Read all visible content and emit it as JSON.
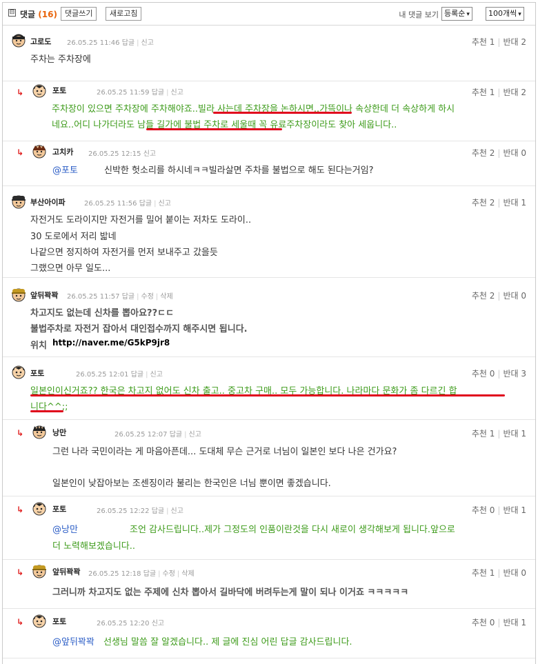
{
  "header": {
    "toggle_icon": "⊟",
    "title": "댓글",
    "count": "(16)",
    "write_button": "댓글쓰기",
    "refresh_button": "새로고침",
    "my_comments": "내 댓글 보기",
    "sort_select": "등록순",
    "per_page_select": "100개씩"
  },
  "labels": {
    "reply": "답글",
    "report": "신고",
    "edit": "수정",
    "delete": "삭제",
    "up": "추천",
    "down": "반대",
    "reply_arrow": "↳",
    "location_label": "위치"
  },
  "comments": [
    {
      "nick": "고로도",
      "date": "26.05.25 11:46",
      "up": "1",
      "down": "2",
      "lines": [
        "주차는 주차장에"
      ]
    },
    {
      "nick": "포토",
      "date": "26.05.25 11:59",
      "up": "1",
      "down": "2",
      "lines": [
        "주차장이 있으면 주차장에 주차해야죠..빌라 사는데 주차장을 논하시면..가뜩이나 속상한데 더 속상하게 하시",
        "네요..어디 나가더라도 남들 길가에 불법 주차로 세울때 꼭 유료주차장이라도 찾아 세웁니다.."
      ]
    },
    {
      "nick": "고치카",
      "date": "26.05.25 12:15",
      "up": "2",
      "down": "0",
      "mention": "@포토",
      "lines": [
        "신박한 헛소리를 하시네ㅋㅋ빌라살면 주차를 불법으로 해도 된다는거임?"
      ]
    },
    {
      "nick": "부산아이파",
      "date": "26.05.25 11:56",
      "up": "2",
      "down": "1",
      "lines": [
        "자전거도 도라이지만 자전거를 밀어 붙이는 저차도 도라이..",
        "30 도로에서 저리 밟네",
        "나같으면 정지하여 자전거를 먼저 보내주고 갔을듯",
        "그랬으면 아무 일도..."
      ]
    },
    {
      "nick": "앞뒤꽉꽉",
      "date": "26.05.25 11:57",
      "up": "2",
      "down": "0",
      "lines": [
        "차고지도 없는데 신차를 뽑아요??ㄷㄷ",
        "불법주차로 자전거 잡아서 대인접수까지 해주시면 됩니다."
      ],
      "url": "http://naver.me/G5kP9jr8"
    },
    {
      "nick": "포토",
      "date": "26.05.25 12:01",
      "up": "0",
      "down": "3",
      "lines": [
        "일본인이신거죠?? 한국은 차고지 없어도 신차 출고.. 중고차 구매.. 모두 가능합니다. 나라마다 문화가 좀 다르긴 합",
        "니다^^;;"
      ]
    },
    {
      "nick": "낭만",
      "date": "26.05.25 12:07",
      "up": "1",
      "down": "1",
      "lines": [
        "그런 나라 국민이라는 게 마음아픈데... 도대체 무슨 근거로 너님이 일본인 보다 나은 건가요?",
        "일본인이 낮잡아보는 조센징이라 불리는 한국인은 너님 뿐이면 좋겠습니다."
      ]
    },
    {
      "nick": "포토",
      "date": "26.05.25 12:22",
      "up": "0",
      "down": "1",
      "mention": "@낭만",
      "lines": [
        "조언 감사드립니다..제가 그정도의 인품이란것을 다시 새로이 생각해보게 됩니다.앞으로",
        "더 노력해보겠습니다.."
      ]
    },
    {
      "nick": "앞뒤꽉꽉",
      "date": "26.05.25 12:18",
      "up": "1",
      "down": "0",
      "lines": [
        "그러니까 차고지도 없는 주제에 신차 뽑아서 길바닥에 버려두는게 말이 되나 이거죠 ㅋㅋㅋㅋㅋ"
      ]
    },
    {
      "nick": "포토",
      "date": "26.05.25 12:20",
      "up": "0",
      "down": "1",
      "mention": "@앞뒤꽉꽉",
      "lines": [
        "선생님 말씀 잘 알겠습니다.. 제 글에 진심 어린 답글 감사드립니다."
      ]
    }
  ],
  "colors": {
    "green_text": "#3d9b1a",
    "mention_blue": "#2a5cc6",
    "count_orange": "#e8630a",
    "highlight_red": "#e0001b"
  }
}
